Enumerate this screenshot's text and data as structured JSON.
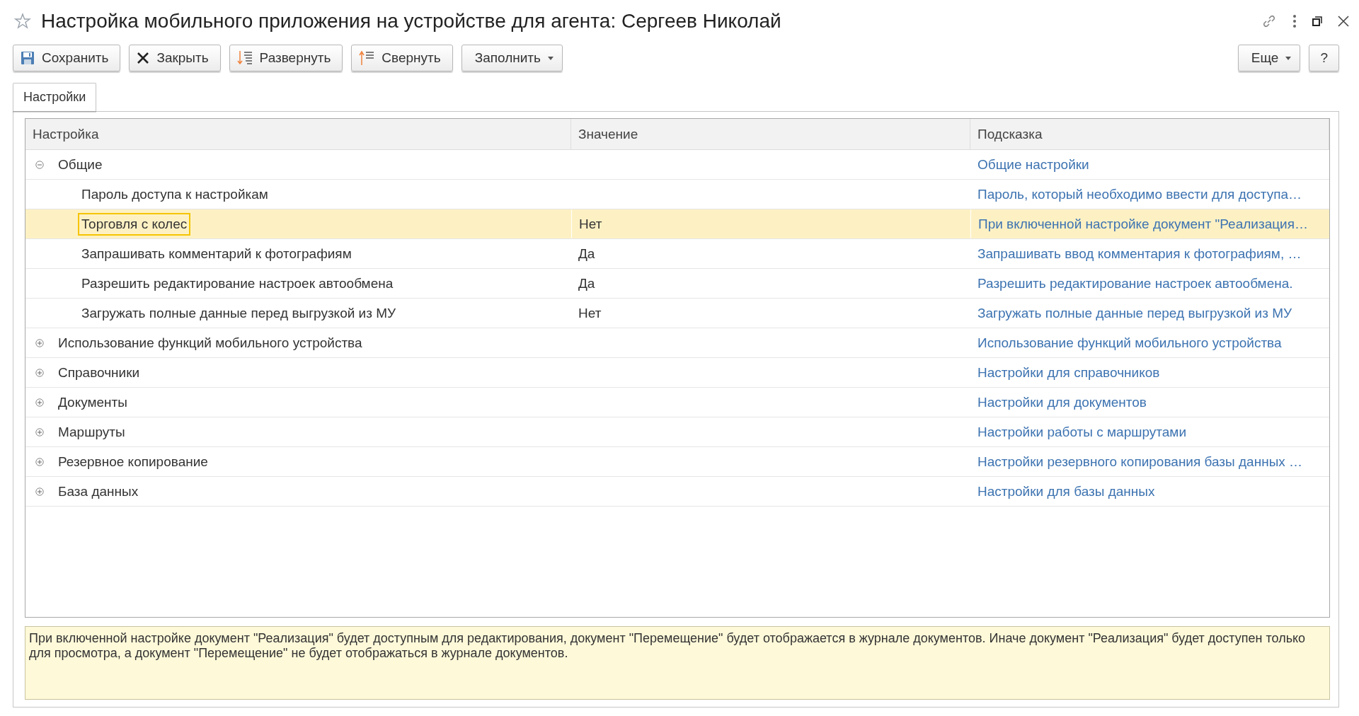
{
  "window": {
    "title": "Настройка мобильного приложения на устройстве для агента: Сергеев Николай",
    "favorite": false
  },
  "toolbar": {
    "buttons": [
      {
        "kind": "save",
        "label": "Сохранить"
      },
      {
        "kind": "close",
        "label": "Закрыть"
      },
      {
        "kind": "expand",
        "label": "Развернуть"
      },
      {
        "kind": "collapse",
        "label": "Свернуть"
      },
      {
        "kind": "menu",
        "label": "Заполнить"
      }
    ],
    "right_buttons": [
      {
        "kind": "menu",
        "label": "Еще"
      },
      {
        "kind": "plain",
        "label": "?"
      }
    ]
  },
  "tabs": [
    {
      "label": "Настройки",
      "selected": true
    }
  ],
  "table": {
    "columns": [
      "Настройка",
      "Значение",
      "Подсказка"
    ],
    "rows": [
      {
        "label": "Общие",
        "hint": "Общие настройки",
        "expanded": true,
        "selected": false,
        "children": [
          {
            "label": "Пароль доступа к настройкам",
            "hint": "Пароль, который необходимо ввести для доступа…",
            "selected": false
          },
          {
            "label": "Торговля с колес",
            "value": "Нет",
            "hint": "При включенной настройке документ \"Реализация…",
            "selected": true
          },
          {
            "label": "Запрашивать комментарий к фотографиям",
            "value": "Да",
            "hint": "Запрашивать ввод комментария к фотографиям, …",
            "selected": false
          },
          {
            "label": "Разрешить редактирование настроек автообмена",
            "value": "Да",
            "hint": "Разрешить редактирование настроек автообмена.",
            "selected": false
          },
          {
            "label": "Загружать полные данные перед выгрузкой из МУ",
            "value": "Нет",
            "hint": "Загружать полные данные перед выгрузкой из МУ",
            "selected": false
          }
        ]
      },
      {
        "label": "Использование функций мобильного устройства",
        "hint": "Использование функций мобильного устройства",
        "expanded": false,
        "selected": false
      },
      {
        "label": "Справочники",
        "hint": "Настройки для справочников",
        "expanded": false,
        "selected": false
      },
      {
        "label": "Документы",
        "hint": "Настройки для документов",
        "expanded": false,
        "selected": false
      },
      {
        "label": "Маршруты",
        "hint": "Настройки работы с маршрутами",
        "expanded": false,
        "selected": false
      },
      {
        "label": "Резервное копирование",
        "hint": "Настройки резервного копирования базы данных …",
        "expanded": false,
        "selected": false
      },
      {
        "label": "База данных",
        "hint": "Настройки для базы данных",
        "expanded": false,
        "selected": false
      }
    ]
  },
  "description": "При включенной настройке документ \"Реализация\" будет доступным для редактирования, документ \"Перемещение\" будет отображается в журнале документов. Иначе документ \"Реализация\" будет доступен только для просмотра, а документ \"Перемещение\" не будет отображаться в журнале документов."
}
